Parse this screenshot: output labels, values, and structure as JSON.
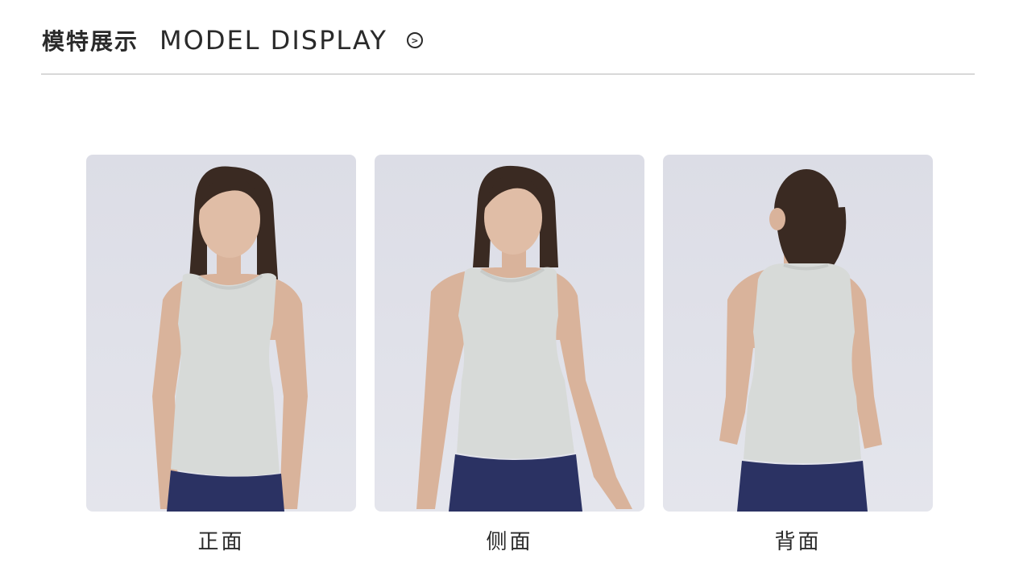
{
  "header": {
    "title_cn": "模特展示",
    "title_en": "MODEL DISPLAY",
    "arrow_glyph": ">"
  },
  "views": [
    {
      "label": "正面",
      "image": "model-front-photo"
    },
    {
      "label": "侧面",
      "image": "model-side-photo"
    },
    {
      "label": "背面",
      "image": "model-back-photo"
    }
  ],
  "colors": {
    "background": "#ffffff",
    "photo_bg": "#e0e1e9",
    "tank_top": "#d7dad8",
    "leggings": "#2b3263",
    "hair": "#3a2a22",
    "skin": "#d9b39b"
  }
}
